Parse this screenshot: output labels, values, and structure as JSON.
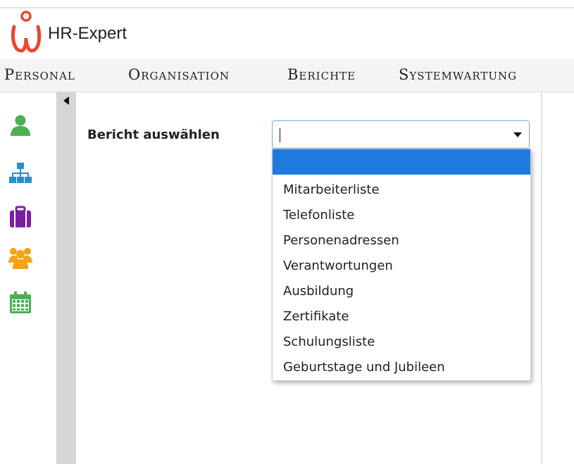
{
  "app": {
    "title": "HR-Expert",
    "logo_icon": "hr-expert-logo",
    "logo_color": "#e8472f"
  },
  "menubar": {
    "items": [
      {
        "label": "Personal"
      },
      {
        "label": "Organisation"
      },
      {
        "label": "Berichte"
      },
      {
        "label": "Systemwartung"
      }
    ]
  },
  "sidebar": {
    "icons": [
      {
        "name": "person-icon",
        "color": "#4caf50"
      },
      {
        "name": "org-chart-icon",
        "color": "#2b8ccf"
      },
      {
        "name": "briefcase-icon",
        "color": "#7b1fa2"
      },
      {
        "name": "group-icon",
        "color": "#f3a31a"
      },
      {
        "name": "calendar-icon",
        "color": "#4caf50"
      }
    ]
  },
  "form": {
    "label": "Bericht auswählen",
    "select": {
      "value": "",
      "options": [
        "",
        "Mitarbeiterliste",
        "Telefonliste",
        "Personenadressen",
        "Verantwortungen",
        "Ausbildung",
        "Zertifikate",
        "Schulungsliste",
        "Geburtstage und Jubileen"
      ],
      "highlighted_index": 0,
      "highlight_color": "#1f7adf"
    }
  }
}
